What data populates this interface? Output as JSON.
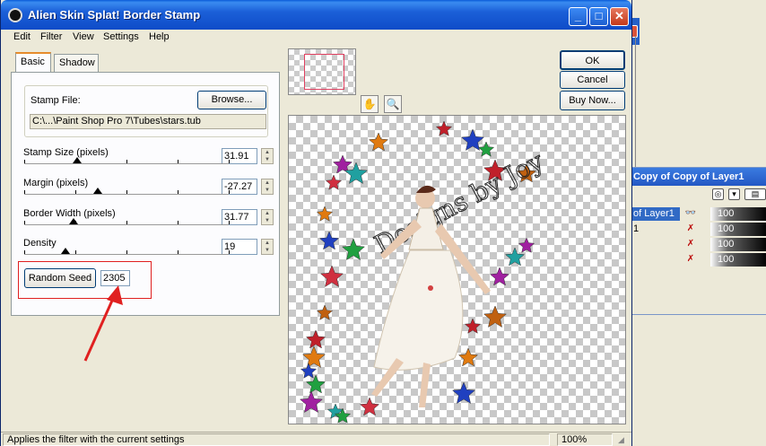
{
  "window": {
    "title": "Alien Skin Splat! Border Stamp",
    "min_glyph": "_",
    "max_glyph": "□",
    "close_glyph": "✕"
  },
  "menu": [
    "Edit",
    "Filter",
    "View",
    "Settings",
    "Help"
  ],
  "tabs": [
    "Basic",
    "Shadow"
  ],
  "stamp_file": {
    "label": "Stamp File:",
    "browse": "Browse...",
    "path": "C:\\...\\Paint Shop Pro 7\\Tubes\\stars.tub"
  },
  "sliders": [
    {
      "label": "Stamp Size (pixels)",
      "value": "31.91",
      "level": 0.26
    },
    {
      "label": "Margin (pixels)",
      "value": "-27.27",
      "level": 0.36
    },
    {
      "label": "Border Width (pixels)",
      "value": "31.77",
      "level": 0.24
    },
    {
      "label": "Density",
      "value": "19",
      "level": 0.2
    }
  ],
  "random_seed": {
    "button": "Random Seed",
    "value": "2305"
  },
  "buttons": {
    "ok": "OK",
    "cancel": "Cancel",
    "buy_now": "Buy Now..."
  },
  "tools": {
    "hand": "✋",
    "zoom": "🔍"
  },
  "status": {
    "text": "Applies the filter with the current settings",
    "zoom": "100%"
  },
  "preview_text": "Designs by Joy",
  "layers_palette": {
    "title": "Copy of Copy of Layer1",
    "rows": [
      {
        "name": "of Layer1",
        "eye": "👓",
        "opacity": "100",
        "selected": true
      },
      {
        "name": "1",
        "eye": "✗",
        "opacity": "100",
        "selected": false
      },
      {
        "name": "",
        "eye": "✗",
        "opacity": "100",
        "selected": false
      },
      {
        "name": "",
        "eye": "✗",
        "opacity": "100",
        "selected": false
      }
    ]
  },
  "colors": {
    "title_bar": "#1b5fd8",
    "highlight": "#e02020",
    "selection": "#316ac5"
  }
}
